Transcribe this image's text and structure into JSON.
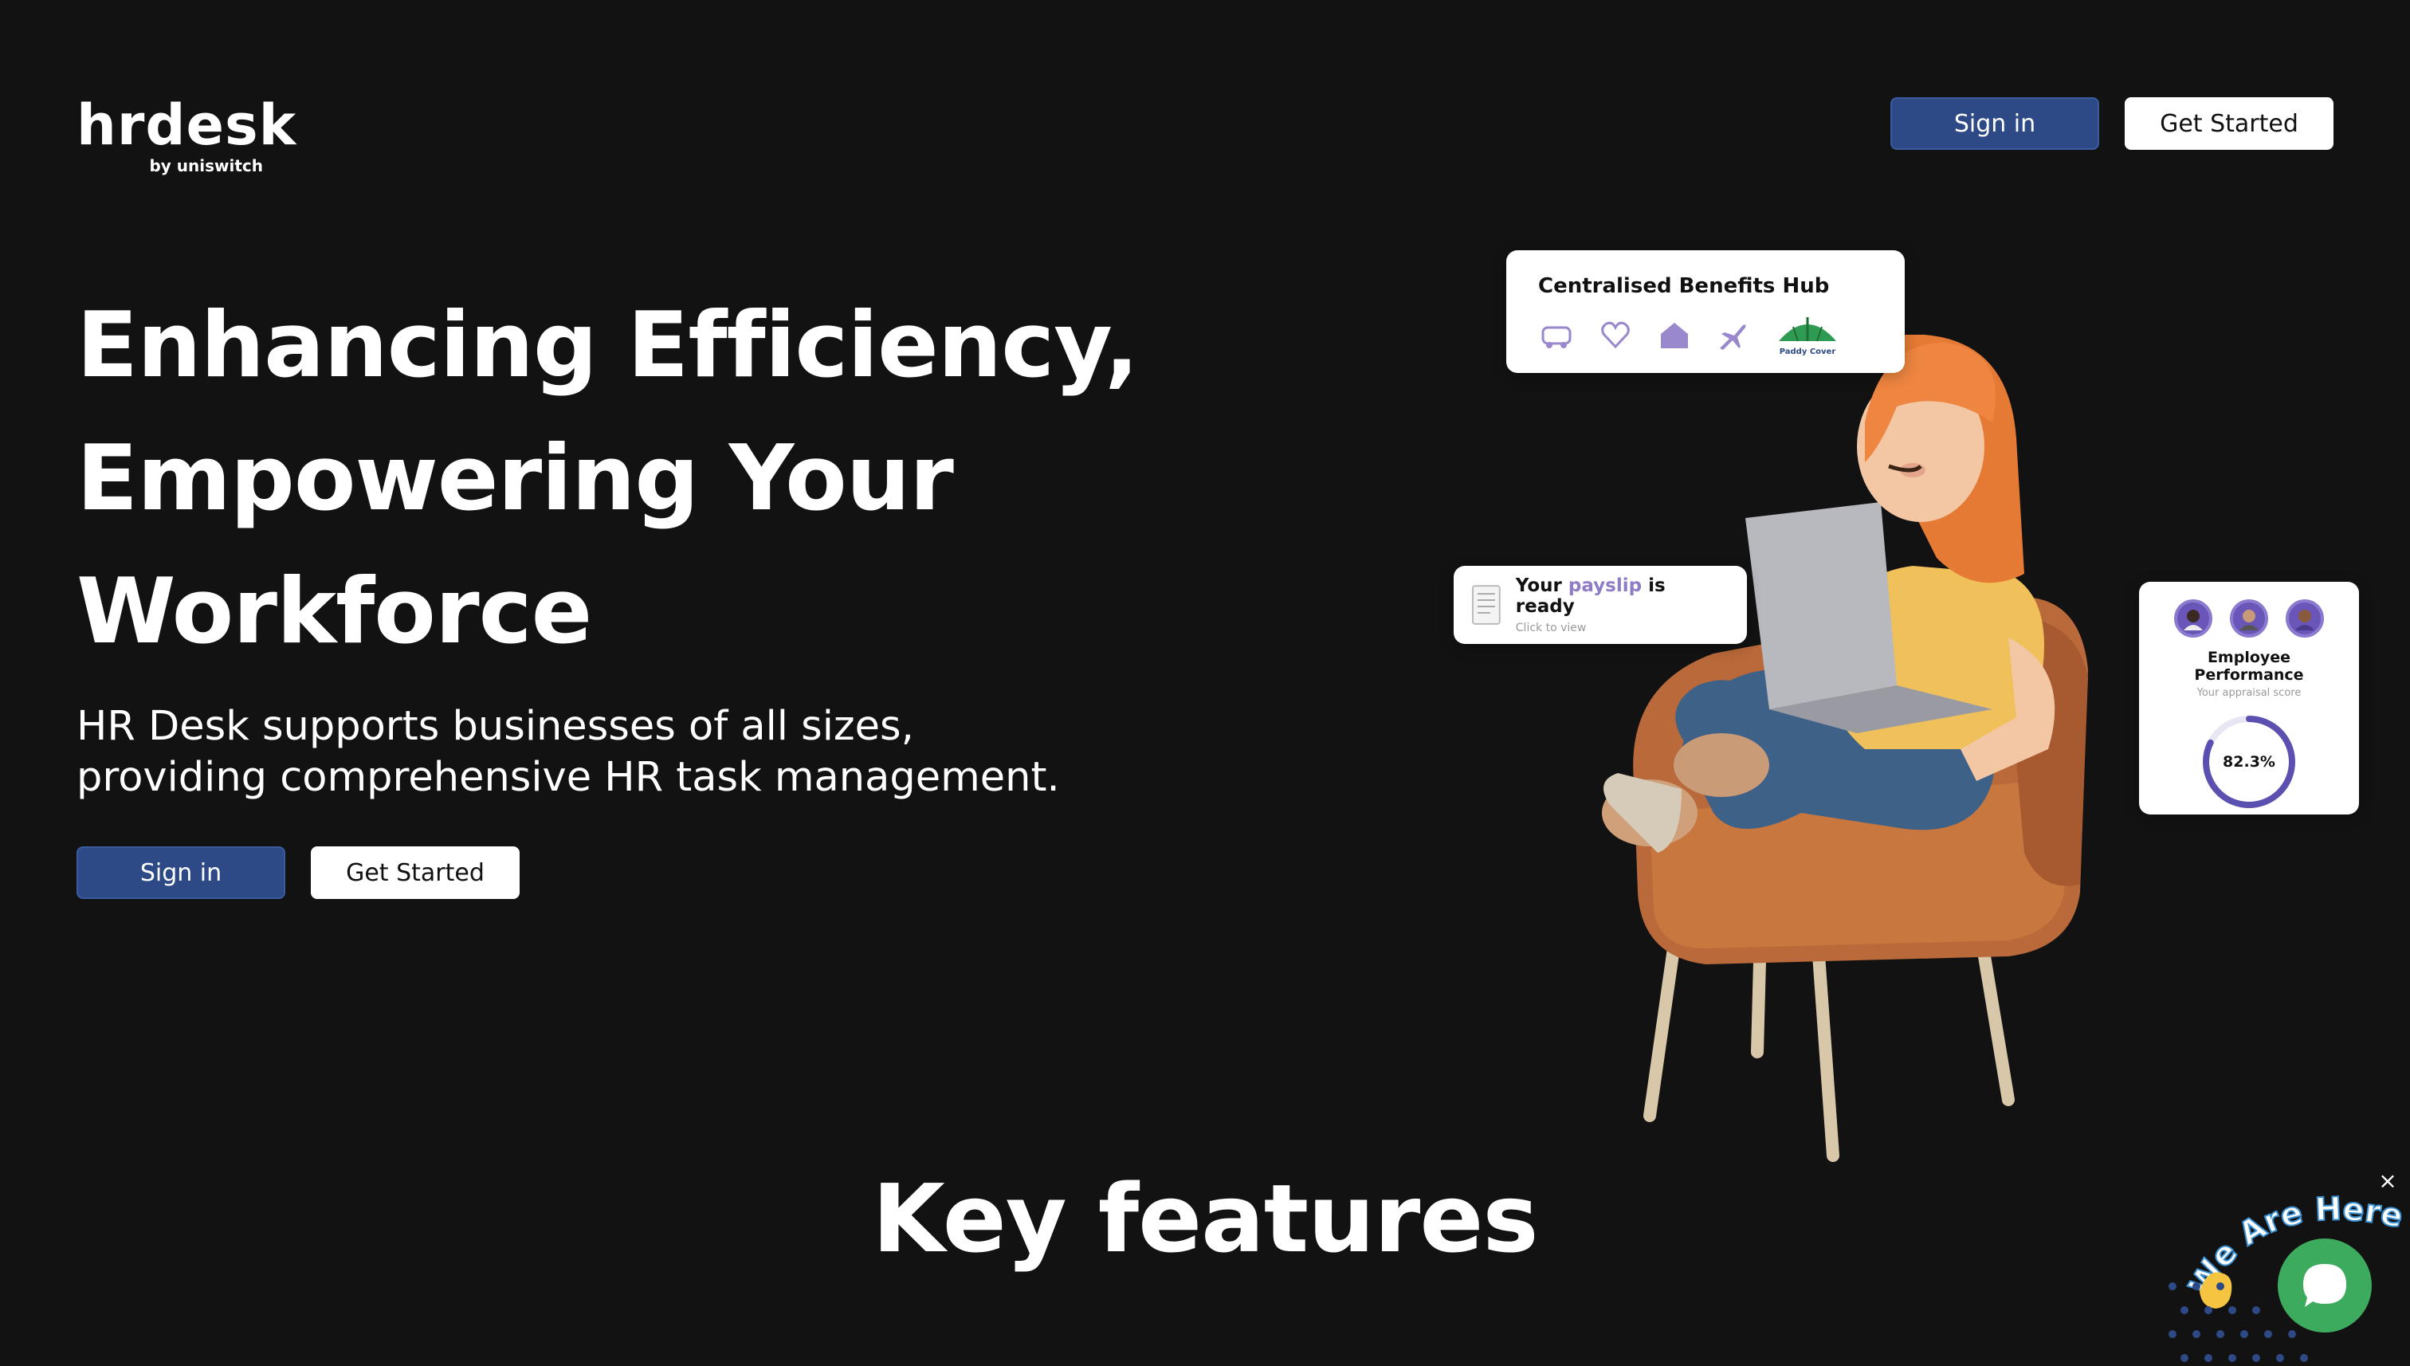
{
  "header": {
    "logo_word": "hrdesk",
    "logo_sub": "by uniswitch",
    "signin_label": "Sign in",
    "get_started_label": "Get Started"
  },
  "hero": {
    "title_lines": [
      "Enhancing Efficiency,",
      "Empowering Your",
      "Workforce"
    ],
    "subtitle": "HR Desk supports businesses of all sizes, providing comprehensive HR task management.",
    "signin_label": "Sign in",
    "get_started_label": "Get Started"
  },
  "cards": {
    "benefits": {
      "title": "Centralised Benefits Hub",
      "icons": [
        "car-icon",
        "heart-icon",
        "home-icon",
        "airplane-icon"
      ],
      "partner_logo_text": "Paddy Cover"
    },
    "payslip": {
      "prefix": "Your",
      "accent": "payslip",
      "suffix": "is ready",
      "hint": "Click to view"
    },
    "performance": {
      "title": "Employee Performance",
      "subtitle": "Your appraisal score",
      "score_label": "82.3%",
      "score": 0.823
    }
  },
  "sections": {
    "features_title": "Key features"
  },
  "chat": {
    "badge_text": "We Are Here!",
    "close_symbol": "×"
  },
  "colors": {
    "background": "#121212",
    "primary_button": "#2e4a86",
    "accent_purple": "#8f7cc4",
    "chat_green": "#3dab5e"
  }
}
